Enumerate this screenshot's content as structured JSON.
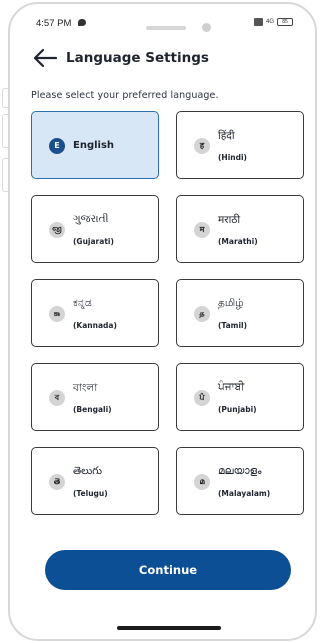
{
  "status_bar": {
    "time": "4:57 PM",
    "network": "4G",
    "battery": "85"
  },
  "header": {
    "title": "Language Settings"
  },
  "instruction": "Please select your preferred language.",
  "languages": [
    {
      "badge": "E",
      "native": "English",
      "roman": "",
      "selected": true
    },
    {
      "badge": "ह",
      "native": "हिंदी",
      "roman": "(Hindi)",
      "selected": false
    },
    {
      "badge": "જી",
      "native": "ગુજરાતી",
      "roman": "(Gujarati)",
      "selected": false
    },
    {
      "badge": "म",
      "native": "मराठी",
      "roman": "(Marathi)",
      "selected": false
    },
    {
      "badge": "ಕಾ",
      "native": "ಕನ್ನಡ",
      "roman": "(Kannada)",
      "selected": false
    },
    {
      "badge": "த",
      "native": "தமிழ்",
      "roman": "(Tamil)",
      "selected": false
    },
    {
      "badge": "ব",
      "native": "বাংলা",
      "roman": "(Bengali)",
      "selected": false
    },
    {
      "badge": "ਪੰ",
      "native": "ਪੰਜਾਬੀ",
      "roman": "(Punjabi)",
      "selected": false
    },
    {
      "badge": "తె",
      "native": "తెలుగు",
      "roman": "(Telugu)",
      "selected": false
    },
    {
      "badge": "മ",
      "native": "മലയാളം",
      "roman": "(Malayalam)",
      "selected": false
    }
  ],
  "continue_label": "Continue",
  "colors": {
    "primary": "#0d4f94",
    "selected_bg": "#d8e7f6",
    "badge_bg": "#d4d4d4"
  }
}
